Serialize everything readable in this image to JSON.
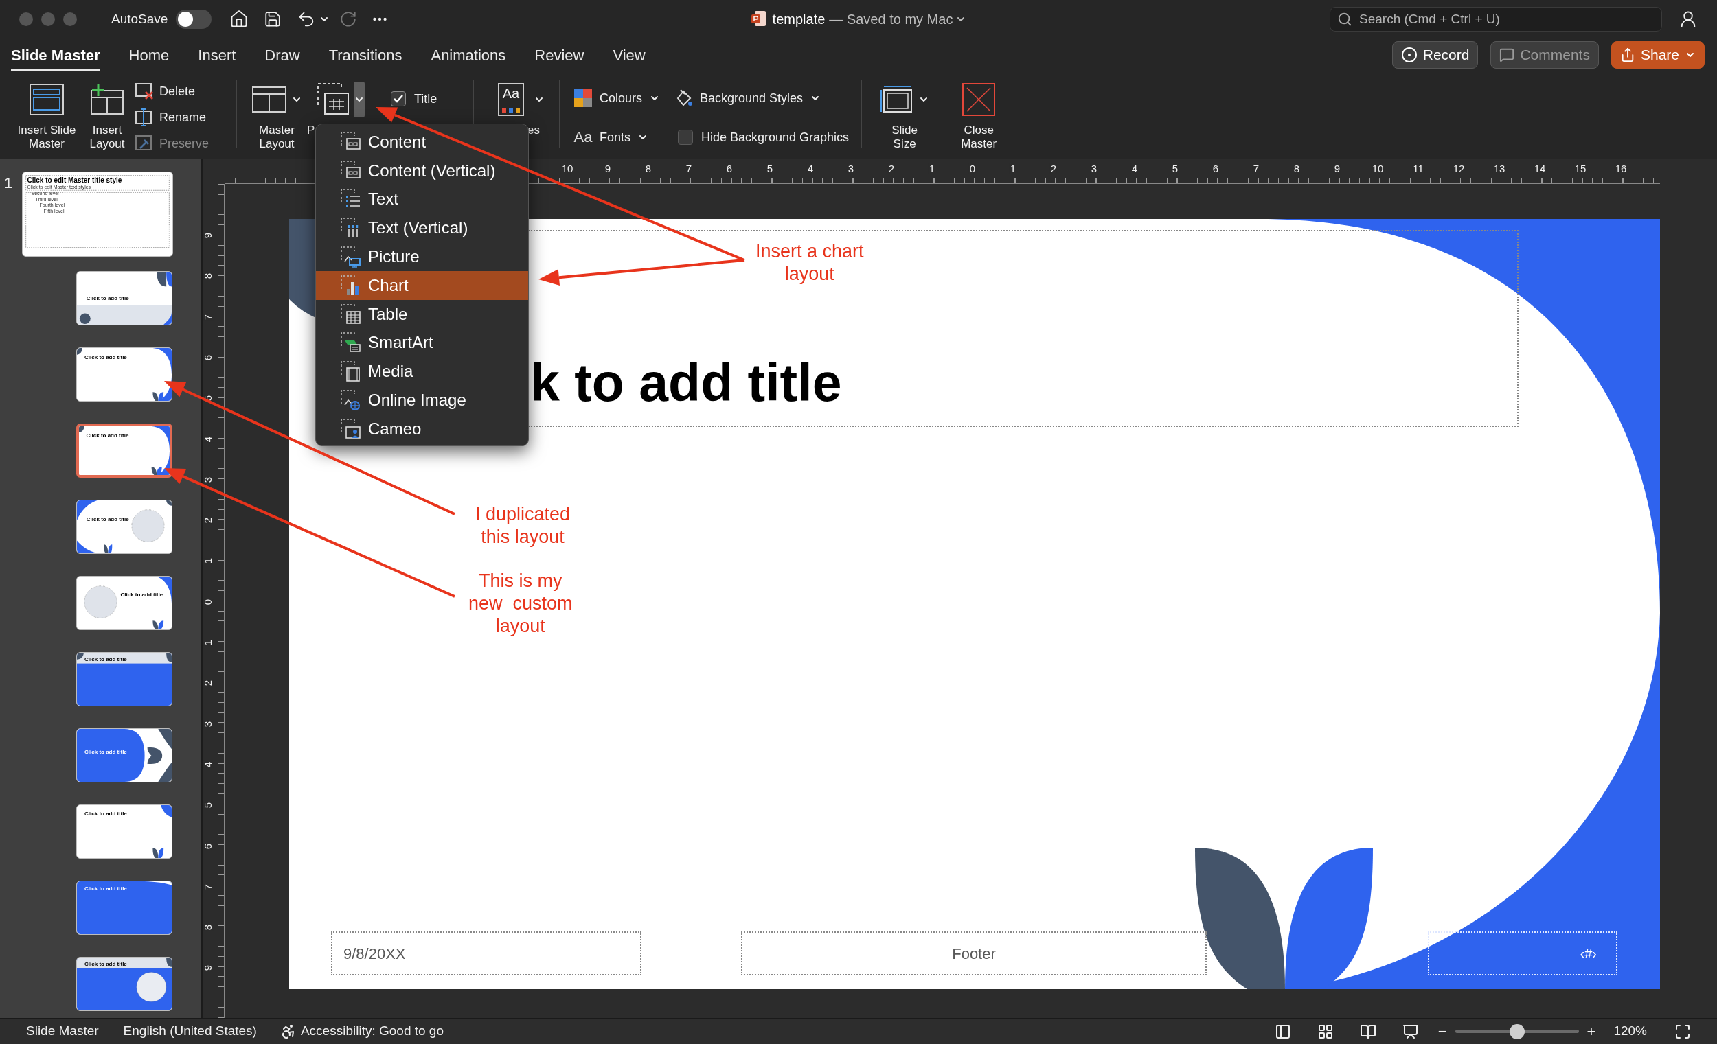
{
  "title_bar": {
    "autosave_label": "AutoSave",
    "autosave_on": false,
    "document_title": "template",
    "save_status": "— Saved to my Mac",
    "search": {
      "placeholder": "Search (Cmd + Ctrl + U)"
    }
  },
  "tabs": [
    {
      "label": "Slide Master",
      "selected": true
    },
    {
      "label": "Home",
      "selected": false
    },
    {
      "label": "Insert",
      "selected": false
    },
    {
      "label": "Draw",
      "selected": false
    },
    {
      "label": "Transitions",
      "selected": false
    },
    {
      "label": "Animations",
      "selected": false
    },
    {
      "label": "Review",
      "selected": false
    },
    {
      "label": "View",
      "selected": false
    }
  ],
  "actions": [
    {
      "label": "Record",
      "kind": "record",
      "disabled": false
    },
    {
      "label": "Comments",
      "kind": "comments",
      "disabled": true
    },
    {
      "label": "Share",
      "kind": "share",
      "disabled": false
    }
  ],
  "ribbon": {
    "large_buttons": [
      {
        "label": "Insert Slide\nMaster",
        "kind": "insert-master"
      },
      {
        "label": "Insert\nLayout",
        "kind": "insert-layout"
      }
    ],
    "small_buttons": [
      {
        "label": "Delete",
        "kind": "delete",
        "disabled": false
      },
      {
        "label": "Rename",
        "kind": "rename",
        "disabled": false
      },
      {
        "label": "Preserve",
        "kind": "preserve",
        "disabled": true
      }
    ],
    "master_layout": {
      "label": "Master\nLayout"
    },
    "insert_placeholder": {
      "label": "P",
      "expanded": true
    },
    "title_checkbox": {
      "label": "Title",
      "checked": true
    },
    "themes": {
      "icon_text": "Aa",
      "label": "es"
    },
    "colours": {
      "label": "Colours"
    },
    "background_styles": {
      "label": "Background Styles"
    },
    "fonts": {
      "icon_text": "Aa",
      "label": "Fonts"
    },
    "hide_background_graphics": {
      "label": "Hide Background Graphics",
      "checked": false
    },
    "slide_size": {
      "label": "Slide\nSize"
    },
    "close_master": {
      "label": "Close\nMaster"
    }
  },
  "placeholder_menu": {
    "items": [
      {
        "label": "Content",
        "kind": "content",
        "selected": false
      },
      {
        "label": "Content (Vertical)",
        "kind": "content-vertical",
        "selected": false
      },
      {
        "label": "Text",
        "kind": "text",
        "selected": false
      },
      {
        "label": "Text (Vertical)",
        "kind": "text-vertical",
        "selected": false
      },
      {
        "label": "Picture",
        "kind": "picture",
        "selected": false
      },
      {
        "label": "Chart",
        "kind": "chart",
        "selected": true
      },
      {
        "label": "Table",
        "kind": "table",
        "selected": false
      },
      {
        "label": "SmartArt",
        "kind": "smartart",
        "selected": false
      },
      {
        "label": "Media",
        "kind": "media",
        "selected": false
      },
      {
        "label": "Online Image",
        "kind": "online-image",
        "selected": false
      },
      {
        "label": "Cameo",
        "kind": "cameo",
        "selected": false
      }
    ]
  },
  "thumbnails": [
    {
      "number": "1",
      "kind": "master",
      "title": "Click to edit Master title style",
      "lines": [
        "Click to edit Master text styles",
        "Second level",
        "Third level",
        "Fourth level",
        "Fifth level"
      ],
      "selected": false
    },
    {
      "kind": "title",
      "title": "Click to add title",
      "selected": false
    },
    {
      "kind": "content",
      "title": "Click to add title",
      "selected": false
    },
    {
      "kind": "title-only",
      "title": "Click to add title",
      "selected": true
    },
    {
      "kind": "title-picture",
      "title": "Click to add title",
      "selected": false
    },
    {
      "kind": "picture-title",
      "title": "Click to add title",
      "selected": false
    },
    {
      "kind": "blue-content",
      "title": "Click to add title",
      "selected": false
    },
    {
      "kind": "section",
      "title": "Click to add title",
      "selected": false
    },
    {
      "kind": "two-content",
      "title": "Click to add title",
      "selected": false
    },
    {
      "kind": "blue-two-content",
      "title": "Click to add title",
      "selected": false
    },
    {
      "kind": "blue-picture",
      "title": "Click to add title",
      "selected": false
    }
  ],
  "rulers": {
    "horizontal": [
      "10",
      "9",
      "8",
      "7",
      "6",
      "5",
      "4",
      "3",
      "2",
      "1",
      "0",
      "1",
      "2",
      "3",
      "4",
      "5",
      "6",
      "7",
      "8",
      "9",
      "10",
      "11",
      "12",
      "13",
      "14",
      "15",
      "16"
    ],
    "vertical": [
      "9",
      "8",
      "7",
      "6",
      "5",
      "4",
      "3",
      "2",
      "1",
      "0",
      "1",
      "2",
      "3",
      "4",
      "5",
      "6",
      "7",
      "8",
      "9"
    ]
  },
  "slide": {
    "title": "k to add title",
    "date": "9/8/20XX",
    "footer": "Footer",
    "slide_number": "‹#›"
  },
  "annotations": [
    {
      "text": "Insert a chart\nlayout"
    },
    {
      "text": "I duplicated\nthis layout"
    },
    {
      "text": "This is my\nnew  custom\nlayout"
    }
  ],
  "status_bar": {
    "view": "Slide Master",
    "language": "English (United States)",
    "accessibility": "Accessibility: Good to go",
    "zoom": {
      "minus": "−",
      "plus": "+",
      "level": 0.5,
      "reading": "120%"
    }
  }
}
